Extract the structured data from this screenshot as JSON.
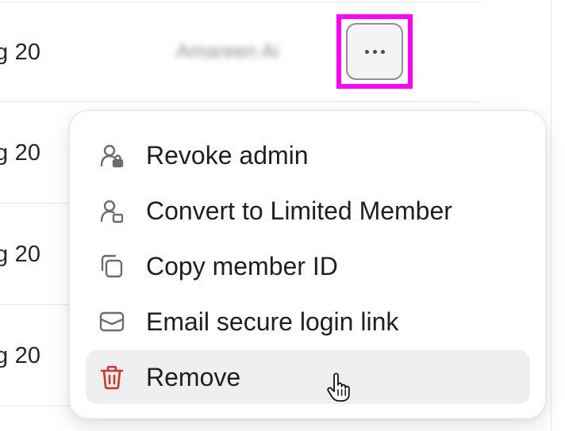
{
  "rows": [
    {
      "date_fragment": "g 20",
      "member_name": "Amareen Ai"
    },
    {
      "date_fragment": "g 20"
    },
    {
      "date_fragment": "g 20"
    },
    {
      "date_fragment": "g 20"
    }
  ],
  "more_button": {
    "icon": "ellipsis-icon"
  },
  "menu": {
    "items": [
      {
        "label": "Revoke admin",
        "icon": "user-lock-icon"
      },
      {
        "label": "Convert to Limited Member",
        "icon": "user-limited-icon"
      },
      {
        "label": "Copy member ID",
        "icon": "copy-icon"
      },
      {
        "label": "Email secure login link",
        "icon": "envelope-icon"
      },
      {
        "label": "Remove",
        "icon": "trash-icon",
        "hovered": true
      }
    ]
  },
  "colors": {
    "highlight": "#ff00ff",
    "danger_icon": "#d0342c",
    "hover_background": "#efefef"
  }
}
